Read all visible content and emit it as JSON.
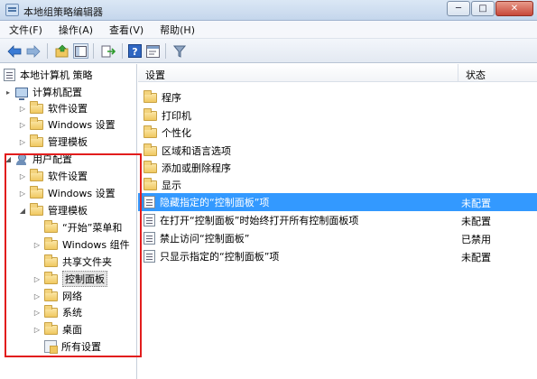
{
  "window": {
    "title": "本地组策略编辑器",
    "buttons": {
      "minimize": "─",
      "maximize": "□",
      "close": "✕"
    }
  },
  "menu": [
    "文件(F)",
    "操作(A)",
    "查看(V)",
    "帮助(H)"
  ],
  "toolbar": {
    "icons": [
      "back-arrow-icon",
      "forward-arrow-icon",
      "up-folder-icon",
      "show-hide-tree-icon",
      "export-list-icon",
      "help-icon",
      "properties-icon",
      "filter-icon"
    ]
  },
  "tree": [
    {
      "label": "本地计算机 策略",
      "icon": "policy-icon",
      "indent": 0,
      "expander": ""
    },
    {
      "label": "计算机配置",
      "icon": "computer-icon",
      "indent": 1,
      "expander": "▸"
    },
    {
      "label": "软件设置",
      "icon": "folder-icon",
      "indent": 2,
      "expander": "▷"
    },
    {
      "label": "Windows 设置",
      "icon": "folder-icon",
      "indent": 2,
      "expander": "▷"
    },
    {
      "label": "管理模板",
      "icon": "folder-icon",
      "indent": 2,
      "expander": "▷"
    },
    {
      "label": "用户配置",
      "icon": "user-icon",
      "indent": 1,
      "expander": "◢"
    },
    {
      "label": "软件设置",
      "icon": "folder-icon",
      "indent": 2,
      "expander": "▷"
    },
    {
      "label": "Windows 设置",
      "icon": "folder-icon",
      "indent": 2,
      "expander": "▷"
    },
    {
      "label": "管理模板",
      "icon": "folder-icon",
      "indent": 2,
      "expander": "◢"
    },
    {
      "label": "“开始”菜单和",
      "icon": "folder-icon",
      "indent": 3,
      "expander": ""
    },
    {
      "label": "Windows 组件",
      "icon": "folder-icon",
      "indent": 3,
      "expander": "▷"
    },
    {
      "label": "共享文件夹",
      "icon": "folder-icon",
      "indent": 3,
      "expander": ""
    },
    {
      "label": "控制面板",
      "icon": "folder-icon",
      "indent": 3,
      "expander": "▷",
      "selected": true
    },
    {
      "label": "网络",
      "icon": "folder-icon",
      "indent": 3,
      "expander": "▷"
    },
    {
      "label": "系统",
      "icon": "folder-icon",
      "indent": 3,
      "expander": "▷"
    },
    {
      "label": "桌面",
      "icon": "folder-icon",
      "indent": 3,
      "expander": "▷"
    },
    {
      "label": "所有设置",
      "icon": "all-settings-icon",
      "indent": 3,
      "expander": ""
    }
  ],
  "list": {
    "columns": {
      "setting": "设置",
      "status": "状态"
    },
    "rows": [
      {
        "name": "程序",
        "status": "",
        "icon": "folder-icon"
      },
      {
        "name": "打印机",
        "status": "",
        "icon": "folder-icon"
      },
      {
        "name": "个性化",
        "status": "",
        "icon": "folder-icon"
      },
      {
        "name": "区域和语言选项",
        "status": "",
        "icon": "folder-icon"
      },
      {
        "name": "添加或删除程序",
        "status": "",
        "icon": "folder-icon"
      },
      {
        "name": "显示",
        "status": "",
        "icon": "folder-icon"
      },
      {
        "name": "隐藏指定的“控制面板”项",
        "status": "未配置",
        "icon": "policy-icon",
        "selected": true
      },
      {
        "name": "在打开“控制面板”时始终打开所有控制面板项",
        "status": "未配置",
        "icon": "policy-icon"
      },
      {
        "name": "禁止访问“控制面板”",
        "status": "已禁用",
        "icon": "policy-icon"
      },
      {
        "name": "只显示指定的“控制面板”项",
        "status": "未配置",
        "icon": "policy-icon"
      }
    ]
  },
  "colors": {
    "selection": "#3399ff",
    "annotation_border": "#e21d1d",
    "titlebar": "#c4d6ec"
  }
}
